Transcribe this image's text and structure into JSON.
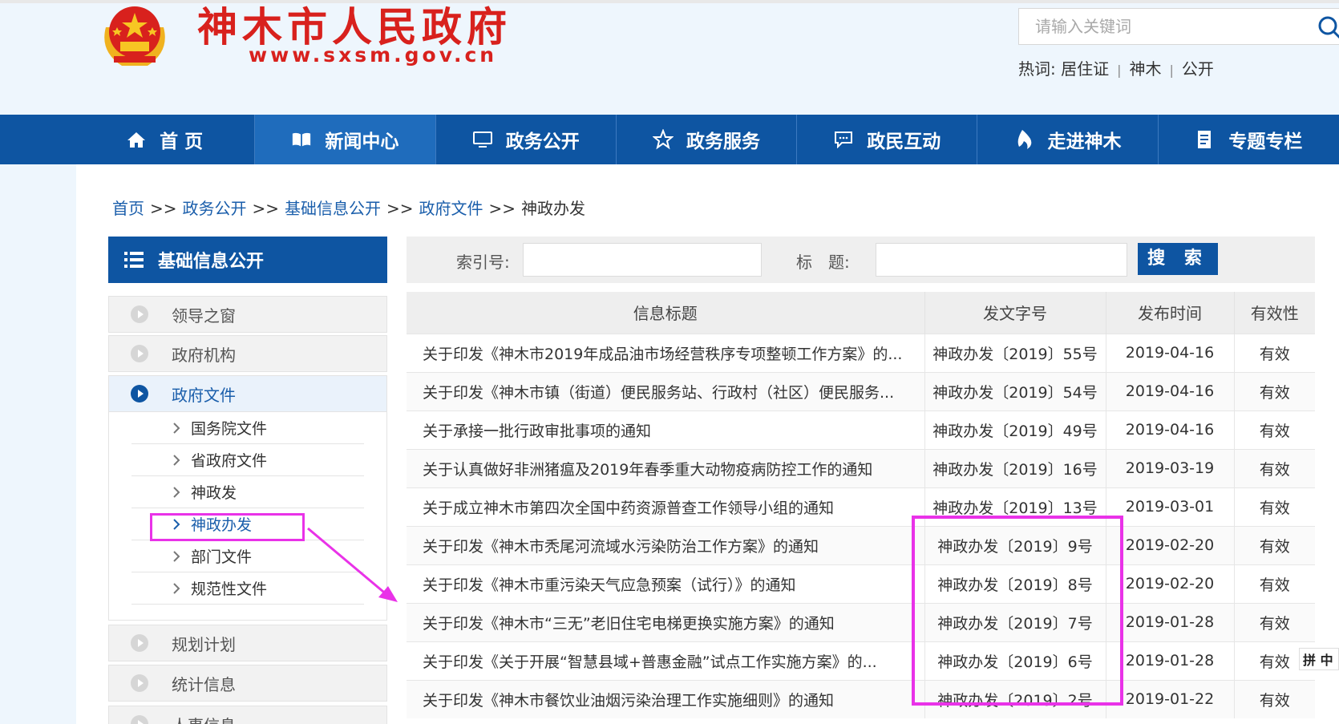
{
  "header": {
    "site_title": "神木市人民政府",
    "site_url": "www.sxsm.gov.cn",
    "search_placeholder": "请输入关键词",
    "hot_label": "热词:",
    "hot_words": [
      "居住证",
      "神木",
      "公开"
    ]
  },
  "nav": {
    "items": [
      {
        "label": "首 页",
        "icon": "home-icon"
      },
      {
        "label": "新闻中心",
        "icon": "book-icon"
      },
      {
        "label": "政务公开",
        "icon": "monitor-icon"
      },
      {
        "label": "政务服务",
        "icon": "star-icon"
      },
      {
        "label": "政民互动",
        "icon": "chat-icon"
      },
      {
        "label": "走进神木",
        "icon": "flame-icon"
      },
      {
        "label": "专题专栏",
        "icon": "document-icon"
      }
    ],
    "active_index": 1
  },
  "breadcrumb": {
    "items": [
      "首页",
      "政务公开",
      "基础信息公开",
      "政府文件"
    ],
    "current": "神政办发",
    "separator": ">>"
  },
  "sidebar": {
    "title": "基础信息公开",
    "items": [
      "领导之窗",
      "政府机构",
      "政府文件",
      "规划计划",
      "统计信息",
      "人事信息"
    ],
    "active_item": "政府文件",
    "submenu": [
      "国务院文件",
      "省政府文件",
      "神政发",
      "神政办发",
      "部门文件",
      "规范性文件"
    ],
    "active_sub": "神政办发"
  },
  "filter": {
    "index_label": "索引号:",
    "title_label": "标　题:",
    "button_label": "搜 索"
  },
  "table": {
    "headers": [
      "信息标题",
      "发文字号",
      "发布时间",
      "有效性"
    ],
    "rows": [
      {
        "title": "关于印发《神木市2019年成品油市场经营秩序专项整顿工作方案》的...",
        "doc_no": "神政办发〔2019〕55号",
        "date": "2019-04-16",
        "validity": "有效"
      },
      {
        "title": "关于印发《神木市镇（街道）便民服务站、行政村（社区）便民服务...",
        "doc_no": "神政办发〔2019〕54号",
        "date": "2019-04-16",
        "validity": "有效"
      },
      {
        "title": "关于承接一批行政审批事项的通知",
        "doc_no": "神政办发〔2019〕49号",
        "date": "2019-04-16",
        "validity": "有效"
      },
      {
        "title": "关于认真做好非洲猪瘟及2019年春季重大动物疫病防控工作的通知",
        "doc_no": "神政办发〔2019〕16号",
        "date": "2019-03-19",
        "validity": "有效"
      },
      {
        "title": "关于成立神木市第四次全国中药资源普查工作领导小组的通知",
        "doc_no": "神政办发〔2019〕13号",
        "date": "2019-03-01",
        "validity": "有效"
      },
      {
        "title": "关于印发《神木市秃尾河流域水污染防治工作方案》的通知",
        "doc_no": "神政办发〔2019〕9号",
        "date": "2019-02-20",
        "validity": "有效"
      },
      {
        "title": "关于印发《神木市重污染天气应急预案（试行）》的通知",
        "doc_no": "神政办发〔2019〕8号",
        "date": "2019-02-20",
        "validity": "有效"
      },
      {
        "title": "关于印发《神木市“三无”老旧住宅电梯更换实施方案》的通知",
        "doc_no": "神政办发〔2019〕7号",
        "date": "2019-01-28",
        "validity": "有效"
      },
      {
        "title": "关于印发《关于开展“智慧县域+普惠金融”试点工作实施方案》的...",
        "doc_no": "神政办发〔2019〕6号",
        "date": "2019-01-28",
        "validity": "有效"
      },
      {
        "title": "关于印发《神木市餐饮业油烟污染治理工作实施细则》的通知",
        "doc_no": "神政办发〔2019〕2号",
        "date": "2019-01-22",
        "validity": "有效"
      }
    ]
  },
  "ime": {
    "label": "拼 中"
  },
  "colors": {
    "nav_blue": "#0e55a2",
    "title_red": "#d8211d",
    "highlight_magenta": "#e932e8",
    "link_blue": "#1a5eab"
  }
}
